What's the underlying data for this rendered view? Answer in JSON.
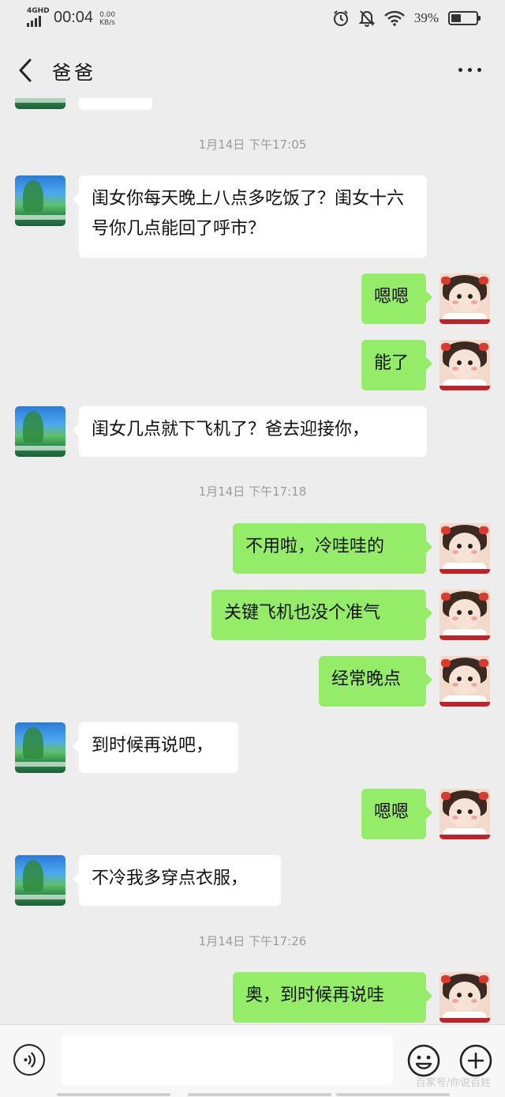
{
  "status_bar": {
    "network": "4GHD",
    "time": "00:04",
    "speed_value": "0.00",
    "speed_unit": "KB/s",
    "battery": "39%",
    "battery_level": 0.39,
    "icons": [
      "alarm-icon",
      "mute-bell-icon",
      "wifi-icon",
      "battery-icon"
    ]
  },
  "header": {
    "title": "爸爸",
    "back_icon": "chevron-left-icon",
    "more_icon": "more-dots-icon"
  },
  "colors": {
    "background": "#ededed",
    "incoming_bubble": "#ffffff",
    "outgoing_bubble": "#95ec69",
    "timestamp_text": "#9a9a9a"
  },
  "messages": [
    {
      "kind": "time",
      "text": "1月14日 下午17:05"
    },
    {
      "kind": "in",
      "text": "闺女你每天晚上八点多吃饭了？闺女十六号你几点能回了呼市？"
    },
    {
      "kind": "out",
      "text": "嗯嗯"
    },
    {
      "kind": "out",
      "text": "能了"
    },
    {
      "kind": "in",
      "text": "闺女几点就下飞机了？爸去迎接你，"
    },
    {
      "kind": "time",
      "text": "1月14日 下午17:18"
    },
    {
      "kind": "out",
      "text": "不用啦，冷哇哇的"
    },
    {
      "kind": "out",
      "text": "关键飞机也没个准气"
    },
    {
      "kind": "out",
      "text": "经常晚点"
    },
    {
      "kind": "in",
      "text": "到时候再说吧，"
    },
    {
      "kind": "out",
      "text": "嗯嗯"
    },
    {
      "kind": "in",
      "text": "不冷我多穿点衣服，"
    },
    {
      "kind": "time",
      "text": "1月14日 下午17:26"
    },
    {
      "kind": "out",
      "text": "奥，到时候再说哇"
    }
  ],
  "input_bar": {
    "voice_icon": "voice-icon",
    "emoji_icon": "emoji-icon",
    "plus_icon": "plus-icon",
    "placeholder": "",
    "watermark": "百家号/你说百姓"
  }
}
